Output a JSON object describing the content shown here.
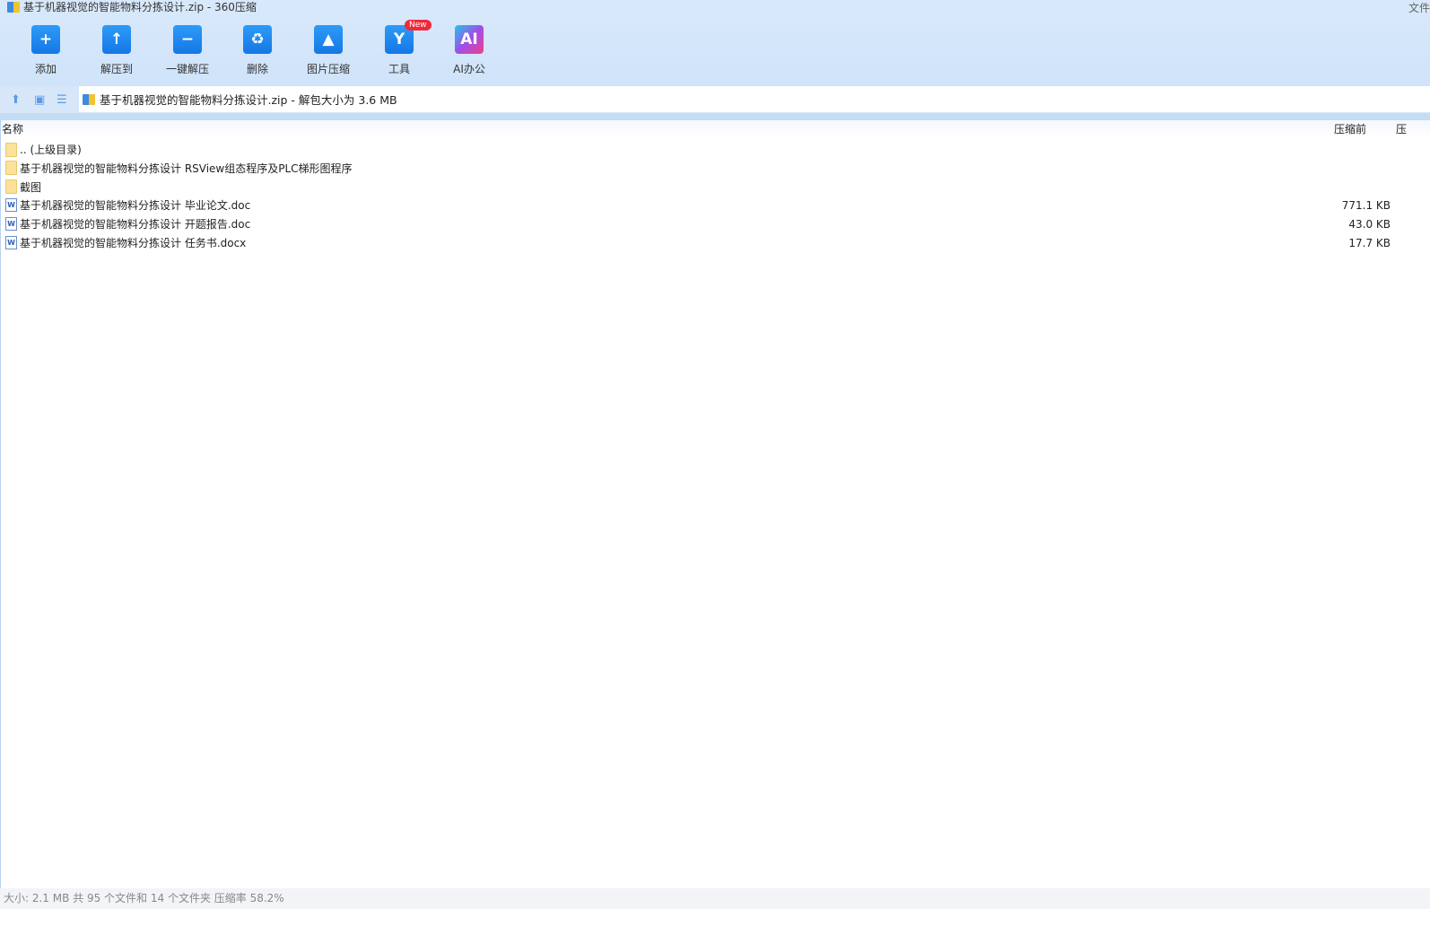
{
  "window": {
    "title": "基于机器视觉的智能物料分拣设计.zip - 360压缩",
    "top_right": "文件"
  },
  "toolbar": [
    {
      "label": "添加",
      "icon": "add-folder-icon",
      "glyph": "+"
    },
    {
      "label": "解压到",
      "icon": "extract-to-icon",
      "glyph": "↑"
    },
    {
      "label": "一键解压",
      "icon": "one-click-extract-icon",
      "glyph": "−"
    },
    {
      "label": "删除",
      "icon": "recycle-bin-icon",
      "glyph": "♻"
    },
    {
      "label": "图片压缩",
      "icon": "image-compress-icon",
      "glyph": "▲"
    },
    {
      "label": "工具",
      "icon": "tools-icon",
      "glyph": "Y",
      "badge": "New"
    },
    {
      "label": "AI办公",
      "icon": "ai-office-icon",
      "glyph": "AI"
    }
  ],
  "address": {
    "path": "基于机器视觉的智能物料分拣设计.zip - 解包大小为 3.6 MB"
  },
  "columns": {
    "name": "名称",
    "original": "压缩前",
    "compressed": "压"
  },
  "files": [
    {
      "type": "folder",
      "name": ".. (上级目录)",
      "size": ""
    },
    {
      "type": "folder",
      "name": "基于机器视觉的智能物料分拣设计 RSView组态程序及PLC梯形图程序",
      "size": ""
    },
    {
      "type": "folder",
      "name": "截图",
      "size": ""
    },
    {
      "type": "doc",
      "name": "基于机器视觉的智能物料分拣设计 毕业论文.doc",
      "size": "771.1 KB"
    },
    {
      "type": "doc",
      "name": "基于机器视觉的智能物料分拣设计 开题报告.doc",
      "size": "43.0 KB"
    },
    {
      "type": "doc",
      "name": "基于机器视觉的智能物料分拣设计 任务书.docx",
      "size": "17.7 KB"
    }
  ],
  "status": "大小: 2.1 MB 共 95 个文件和 14 个文件夹 压缩率 58.2%"
}
